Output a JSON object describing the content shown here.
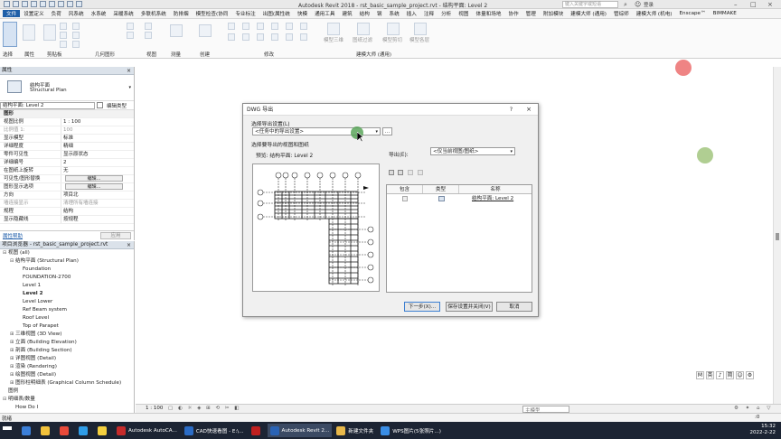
{
  "window": {
    "title": "Autodesk Revit 2018 -    rst_basic_sample_project.rvt - 结构平面: Level 2",
    "search_placeholder": "键入关键字或短语",
    "user": "登录"
  },
  "menu": [
    "文件",
    "设置定义",
    "负荷",
    "风系统",
    "水系统",
    "采暖系统",
    "多联机系统",
    "防排烟",
    "模型检查(协同",
    "专业标注",
    "出图(属性统",
    "快模",
    "通用工具",
    "建筑",
    "结构",
    "钢",
    "系统",
    "插入",
    "注释",
    "分析",
    "视图",
    "体量和场地",
    "协作",
    "管理",
    "附加模块",
    "建模大师 (通用)",
    "管综师",
    "建模大师 (机电)",
    "Enscape™",
    "BIMMAKE"
  ],
  "ribbon": {
    "groups": [
      {
        "label": "选择"
      },
      {
        "label": "属性"
      },
      {
        "label": "剪贴板"
      },
      {
        "label": "几何图形"
      },
      {
        "label": "视图"
      },
      {
        "label": "测量"
      },
      {
        "label": "创建"
      },
      {
        "label": "修改"
      },
      {
        "label": "建模大师 (通用)"
      }
    ],
    "top_labels": [
      "模型三维",
      "图纸过滤",
      "模型剪切",
      "模型各层"
    ]
  },
  "properties": {
    "title": "属性",
    "type_name_1": "结构平面",
    "type_name_2": "Structural Plan",
    "instance_selector": "结构平面: Level 2",
    "edit_type": "编辑类型",
    "rows": [
      {
        "k": "图形",
        "v": "",
        "section": true
      },
      {
        "k": "视图比例",
        "v": "1 : 100"
      },
      {
        "k": "比例值 1:",
        "v": "100",
        "grey": true
      },
      {
        "k": "显示模型",
        "v": "标准"
      },
      {
        "k": "详细程度",
        "v": "精细"
      },
      {
        "k": "零件可见性",
        "v": "显示原状态"
      },
      {
        "k": "详细编号",
        "v": "2"
      },
      {
        "k": "在图纸上旋转",
        "v": "无"
      },
      {
        "k": "可见性/图形替换",
        "v": "",
        "button": "编辑..."
      },
      {
        "k": "图形显示选项",
        "v": "",
        "button": "编辑..."
      },
      {
        "k": "方向",
        "v": "项目北"
      },
      {
        "k": "墙连接显示",
        "v": "清理所有墙连接",
        "grey": true
      },
      {
        "k": "规程",
        "v": "结构"
      },
      {
        "k": "显示隐藏线",
        "v": "按规程"
      }
    ],
    "help_link": "属性帮助",
    "apply": "应用"
  },
  "browser": {
    "title": "项目浏览器 - rst_basic_sample_project.rvt",
    "items": [
      {
        "label": "视图 (all)",
        "level": 0,
        "exp": "−"
      },
      {
        "label": "结构平面 (Structural Plan)",
        "level": 1,
        "exp": "−"
      },
      {
        "label": "Foundation",
        "level": 2
      },
      {
        "label": "FOUNDATION-2700",
        "level": 2
      },
      {
        "label": "Level 1",
        "level": 2
      },
      {
        "label": "Level 2",
        "level": 2,
        "bold": true
      },
      {
        "label": "Level Lower",
        "level": 2
      },
      {
        "label": "Ref Beam system",
        "level": 2
      },
      {
        "label": "Roof Level",
        "level": 2
      },
      {
        "label": "Top of Parapet",
        "level": 2
      },
      {
        "label": "三维视图 (3D View)",
        "level": 1,
        "exp": "+"
      },
      {
        "label": "立面 (Building Elevation)",
        "level": 1,
        "exp": "+"
      },
      {
        "label": "剖面 (Building Section)",
        "level": 1,
        "exp": "+"
      },
      {
        "label": "详图视图 (Detail)",
        "level": 1,
        "exp": "+"
      },
      {
        "label": "渲染 (Rendering)",
        "level": 1,
        "exp": "+"
      },
      {
        "label": "绘图视图 (Detail)",
        "level": 1,
        "exp": "+"
      },
      {
        "label": "图形柱明细表 (Graphical Column Schedule)",
        "level": 1,
        "exp": "+"
      },
      {
        "label": "图例",
        "level": 0
      },
      {
        "label": "明细表/数量",
        "level": 0,
        "exp": "−"
      },
      {
        "label": "How Do I",
        "level": 1
      }
    ]
  },
  "view_status": {
    "scale": "1 : 100",
    "model": "主模型"
  },
  "app_status": {
    "ready": "就绪",
    "filter_count": ":0"
  },
  "dialog": {
    "title": "DWG 导出",
    "help": "?",
    "select_setup_label": "选择导出设置(L)",
    "setup_value": "<任务中的导出设置>",
    "select_views_label": "选择要导出的视图和图纸",
    "preview_label": "预览:  结构平面: Level 2",
    "export_label": "导出(E):",
    "export_value": "<仅当前视图/图纸>",
    "columns": [
      "包含",
      "类型",
      "名称"
    ],
    "row": {
      "name": "结构平面: Level 2"
    },
    "buttons": {
      "next": "下一步(X)...",
      "save_close": "保存设置并关闭(V)",
      "cancel": "取消"
    }
  },
  "ime": [
    "M",
    "英",
    "♪",
    "简",
    "☺",
    "⚙"
  ],
  "taskbar": {
    "items": [
      {
        "label": "",
        "color": "#ffffff"
      },
      {
        "label": "",
        "color": "#3b7fd8"
      },
      {
        "label": "",
        "color": "#f2c23c"
      },
      {
        "label": "",
        "color": "#e84a3a"
      },
      {
        "label": "",
        "color": "#2f9de8"
      },
      {
        "label": "",
        "color": "#f4d03f"
      },
      {
        "label": "Autodesk AutoCA...",
        "color": "#c62b2b"
      },
      {
        "label": "CAD快速看图 - E:\\...",
        "color": "#2b6cc6"
      },
      {
        "label": "",
        "color": "#c02020"
      },
      {
        "label": "Autodesk Revit 2...",
        "color": "#2a63b5",
        "active": true
      },
      {
        "label": "新建文件夹",
        "color": "#e8b84a"
      },
      {
        "label": "WPS图片(5张照片...)",
        "color": "#3a8ee6"
      }
    ],
    "time": "15:32",
    "date": "2022-2-22"
  },
  "accent": "#2a63b5"
}
